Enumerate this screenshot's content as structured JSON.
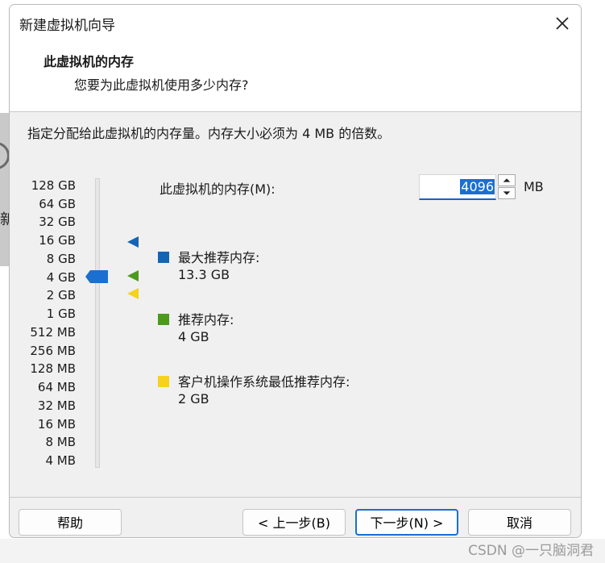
{
  "background": {
    "sidebar_char": "新"
  },
  "watermark": "CSDN @一只脑洞君",
  "dialog": {
    "title": "新建虚拟机向导",
    "page_title": "此虚拟机的内存",
    "page_subtitle": "您要为此虚拟机使用多少内存?",
    "instruction": "指定分配给此虚拟机的内存量。内存大小必须为 4 MB 的倍数。"
  },
  "scale": {
    "ticks": [
      "128 GB",
      "64 GB",
      "32 GB",
      "16 GB",
      "8 GB",
      "4 GB",
      "2 GB",
      "1 GB",
      "512 MB",
      "256 MB",
      "128 MB",
      "64 MB",
      "32 MB",
      "16 MB",
      "8 MB",
      "4 MB"
    ],
    "selected": "4 GB",
    "max_recommended_at": "16 GB",
    "recommended_at": "4 GB",
    "min_recommended_at": "2 GB"
  },
  "memory": {
    "label": "此虚拟机的内存(M):",
    "value": "4096",
    "unit": "MB"
  },
  "legend": [
    {
      "label": "最大推荐内存:",
      "value": "13.3 GB",
      "color": "#1464b4"
    },
    {
      "label": "推荐内存:",
      "value": "4 GB",
      "color": "#4c9a1c"
    },
    {
      "label": "客户机操作系统最低推荐内存:",
      "value": "2 GB",
      "color": "#f5d21e"
    }
  ],
  "buttons": {
    "help": "帮助",
    "back": "< 上一步(B)",
    "next": "下一步(N) >",
    "cancel": "取消"
  },
  "colors": {
    "accent": "#1a6fd1",
    "dialog_bg": "#f0f0f0"
  }
}
